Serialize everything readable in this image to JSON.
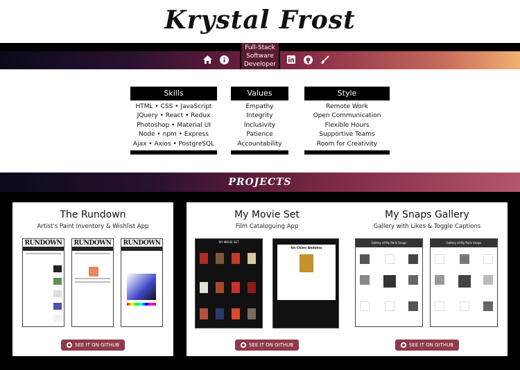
{
  "site": {
    "title": "Krystal Frost"
  },
  "nav": {
    "role_lines": [
      "Full-Stack",
      "Software",
      "Developer"
    ],
    "left_icons": [
      "home-icon",
      "info-icon"
    ],
    "right_icons": [
      "linkedin-icon",
      "github-icon",
      "paintbrush-icon"
    ]
  },
  "info": {
    "skills": {
      "heading": "Skills",
      "items": [
        "HTML • CSS • JavaScript",
        "JQuery • React • Redux",
        "Photoshop • Material UI",
        "Node • npm • Express",
        "Ajax • Axios • PostgreSQL"
      ]
    },
    "values": {
      "heading": "Values",
      "items": [
        "Empathy",
        "Integrity",
        "Inclusivity",
        "Patience",
        "Accountability"
      ]
    },
    "style": {
      "heading": "Style",
      "items": [
        "Remote Work",
        "Open Communication",
        "Flexible Hours",
        "Supportive Teams",
        "Room for Creativity"
      ]
    }
  },
  "projects": {
    "heading": "PROJECTS",
    "cards": [
      {
        "name": "The Rundown",
        "subtitle": "Artist's Paint Inventory & Wishlist App",
        "button": "SEE IT ON GITHUB"
      },
      {
        "name": "My Movie Set",
        "subtitle": "Film Cataloguing App",
        "button": "SEE IT ON GITHUB"
      },
      {
        "name": "My Snaps Gallery",
        "subtitle": "Gallery with Likes & Toggle Captions",
        "button": "SEE IT ON GITHUB"
      }
    ]
  },
  "screens": {
    "rundown_logo": "RUNDOWN",
    "movie_header": "MY MOVIE SET",
    "movie_detail_title": "Un Chien Andalou",
    "gallery_header": "Gallery of My Paris Snaps"
  },
  "colors": {
    "accent": "#8f3a4b",
    "nav_dark": "#0a0a1c",
    "nav_light": "#f0b070"
  }
}
